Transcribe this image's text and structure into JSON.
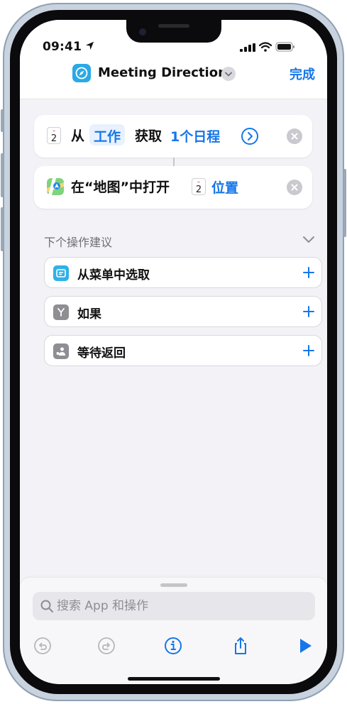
{
  "status_bar": {
    "time": "09:41"
  },
  "nav": {
    "title": "Meeting Directions",
    "done_label": "完成"
  },
  "actions": [
    {
      "calendar_day": "2",
      "prefix": "从",
      "source_token": "工作",
      "verb": "获取",
      "count_token": "1个日程"
    },
    {
      "text": "在“地图”中打开",
      "calendar_day": "2",
      "location_token": "位置"
    }
  ],
  "suggestions": {
    "header": "下个操作建议",
    "items": [
      {
        "label": "从菜单中选取",
        "icon": "menu-icon",
        "color": "#30b0e8"
      },
      {
        "label": "如果",
        "icon": "branch-icon",
        "color": "#8e8e93"
      },
      {
        "label": "等待返回",
        "icon": "wait-icon",
        "color": "#8e8e93"
      }
    ]
  },
  "search": {
    "placeholder": "搜索 App 和操作"
  },
  "colors": {
    "accent": "#1576e9",
    "app_icon": "#2aa9e6",
    "background": "#f2f2f7"
  }
}
